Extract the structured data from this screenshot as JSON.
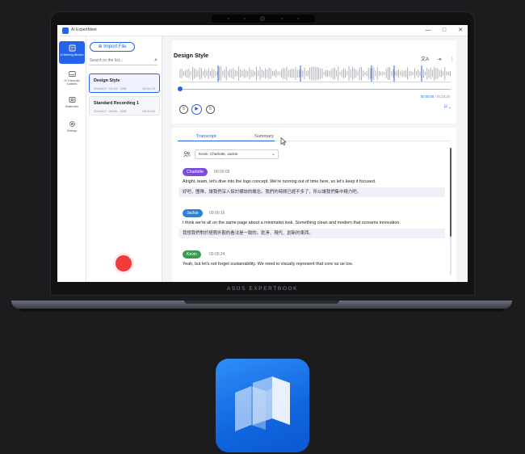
{
  "window": {
    "app_title": "AI ExpertMeet",
    "minimize_glyph": "—",
    "maximize_glyph": "□",
    "close_glyph": "✕"
  },
  "nav": {
    "items": [
      {
        "label": "AI Meeting Minutes",
        "icon": "meeting-minutes-icon",
        "active": true
      },
      {
        "label": "AI Transcript Subtitles",
        "icon": "subtitles-icon",
        "active": false
      },
      {
        "label": "Watermark",
        "icon": "watermark-icon",
        "active": false
      },
      {
        "label": "Settings",
        "icon": "gear-icon",
        "active": false
      }
    ]
  },
  "list": {
    "import_label": "Import File",
    "search_placeholder": "Search in the list...",
    "recordings": [
      {
        "title": "Design Style",
        "date": "2024/4/2 · 04:24 · 22M",
        "duration": "00:24:20",
        "selected": true
      },
      {
        "title": "Standard Recording 1",
        "date": "2024/4/2 · 08:06 · 22M",
        "duration": "00:31:50",
        "selected": false
      }
    ]
  },
  "player": {
    "title": "Design Style",
    "current_time": "00:00:00",
    "total_time": " / 01:24:20",
    "progress": 0.0,
    "rewind_label": "5",
    "forward_label": "5"
  },
  "transcript": {
    "tab_transcript": "Transcript",
    "tab_summary": "Summary",
    "speaker_filter": "Kevin, Charlotte, Jackie",
    "segments": [
      {
        "speaker": "Charlotte",
        "color": "#7c4ddb",
        "time": "00:00:05",
        "text_en": "Alright, team, let's dive into the logo concept. We're running out of time here, so let's keep it focused.",
        "text_zh": "好吧，團隊，讓我們深入探討標誌的概念。我們的時間已經不多了，所以讓我們集中精力吧。"
      },
      {
        "speaker": "Jackie",
        "color": "#2f7fd6",
        "time": "00:00:16",
        "text_en": "I think we're all on the same page about a minimalist look. Something clean and modern that screams innovation.",
        "text_zh": "我想我們對於極簡外觀的看法是一致的。乾淨、現代、創新的東西。"
      },
      {
        "speaker": "Kevin",
        "color": "#3d9a55",
        "time": "00:00:24",
        "text_en": "Yeah, but let's not forget sustainability. We need to visually represent that core va ue too.",
        "text_zh": ""
      }
    ]
  },
  "device": {
    "brand": "ASUS EXPERTBOOK"
  },
  "colors": {
    "accent": "#2563eb",
    "record": "#ef3b3b"
  }
}
